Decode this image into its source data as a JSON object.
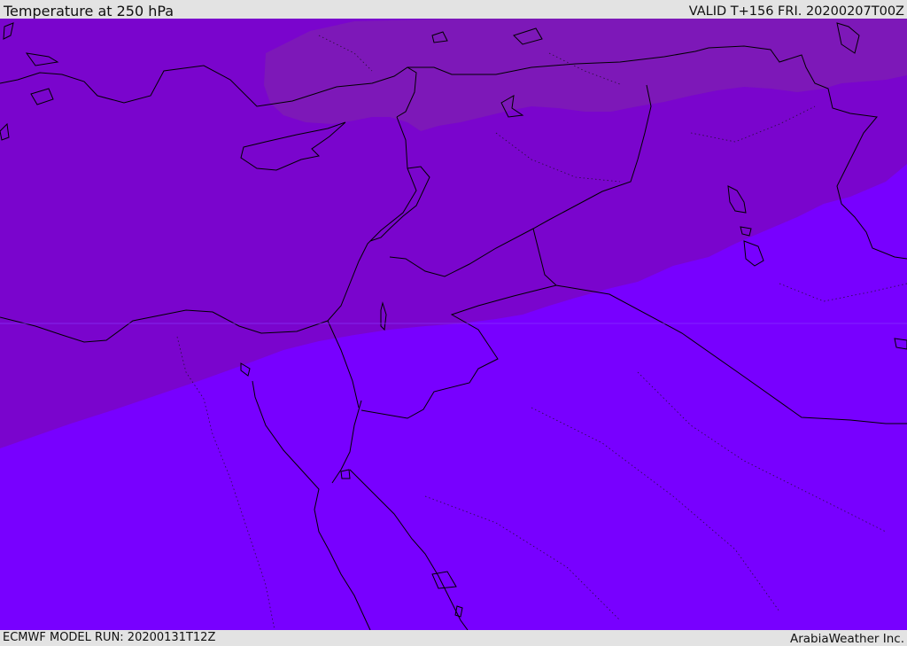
{
  "header": {
    "title": "Temperature at 250 hPa",
    "valid_time": "VALID T+156 FRI. 20200207T00Z"
  },
  "footer": {
    "model_run": "ECMWF MODEL RUN: 20200131T12Z",
    "credit": "ArabiaWeather Inc."
  },
  "map": {
    "colors": {
      "band_coldest": "#7d18b8",
      "band_cold": "#7a05cd",
      "band_cool": "#7800ff",
      "coastline": "#000000",
      "border": "#000000"
    }
  }
}
